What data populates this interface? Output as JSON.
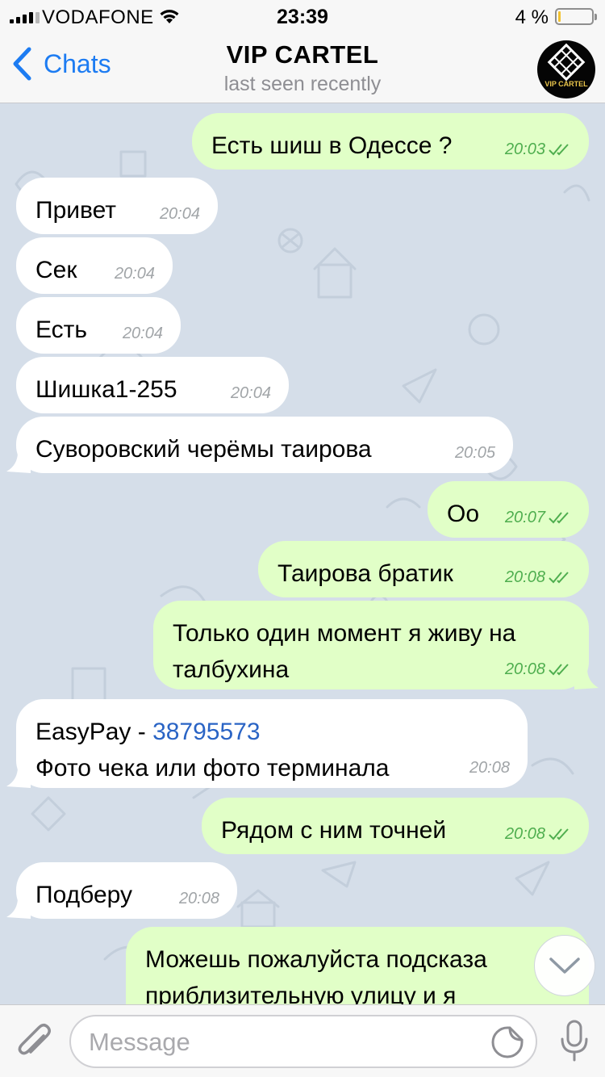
{
  "status_bar": {
    "carrier": "VODAFONE",
    "time": "23:39",
    "battery": "4 %",
    "battery_level": 0.04,
    "icons": [
      "signal-icon",
      "wifi-icon",
      "battery-icon"
    ]
  },
  "header": {
    "back_label": "Chats",
    "title": "VIP CARTEL",
    "subtitle": "last seen recently",
    "avatar_text": "VIP CARTEL"
  },
  "messages": [
    {
      "dir": "out",
      "text": "Есть шиш в Одессе ?",
      "time": "20:03",
      "read": true
    },
    {
      "dir": "in",
      "text": "Привет",
      "time": "20:04"
    },
    {
      "dir": "in",
      "text": "Сек",
      "time": "20:04"
    },
    {
      "dir": "in",
      "text": "Есть",
      "time": "20:04"
    },
    {
      "dir": "in",
      "text": "Шишка1-255",
      "time": "20:04"
    },
    {
      "dir": "in",
      "text": "Суворовский черёмы таирова",
      "time": "20:05"
    },
    {
      "dir": "out",
      "text": "Оо",
      "time": "20:07",
      "read": true
    },
    {
      "dir": "out",
      "text": "Таирова братик",
      "time": "20:08",
      "read": true
    },
    {
      "dir": "out",
      "line1": "Только один момент я живу на",
      "line2": "талбухина",
      "time": "20:08",
      "read": true
    },
    {
      "dir": "in",
      "prefix": "EasyPay - ",
      "link": "38795573",
      "line2": "Фото чека или фото терминала",
      "time": "20:08"
    },
    {
      "dir": "out",
      "text": "Рядом с ним точней",
      "time": "20:08",
      "read": true
    },
    {
      "dir": "in",
      "text": "Подберу",
      "time": "20:08"
    },
    {
      "dir": "out",
      "line1": "Можешь пожалуйста подсказа",
      "line2": "приблизительную улицу и я"
    }
  ],
  "input": {
    "placeholder": "Message"
  },
  "colors": {
    "accent": "#1d7cf2",
    "outgoing_bubble": "#e1ffc7",
    "incoming_bubble": "#ffffff",
    "read_ticks": "#4fae4f",
    "link": "#2a64c5",
    "chat_background": "#d5dee9"
  },
  "icons": {
    "back": "chevron-left-icon",
    "attach": "paperclip-icon",
    "sticker": "sticker-icon",
    "mic": "microphone-icon",
    "scroll": "chevron-down-icon"
  }
}
